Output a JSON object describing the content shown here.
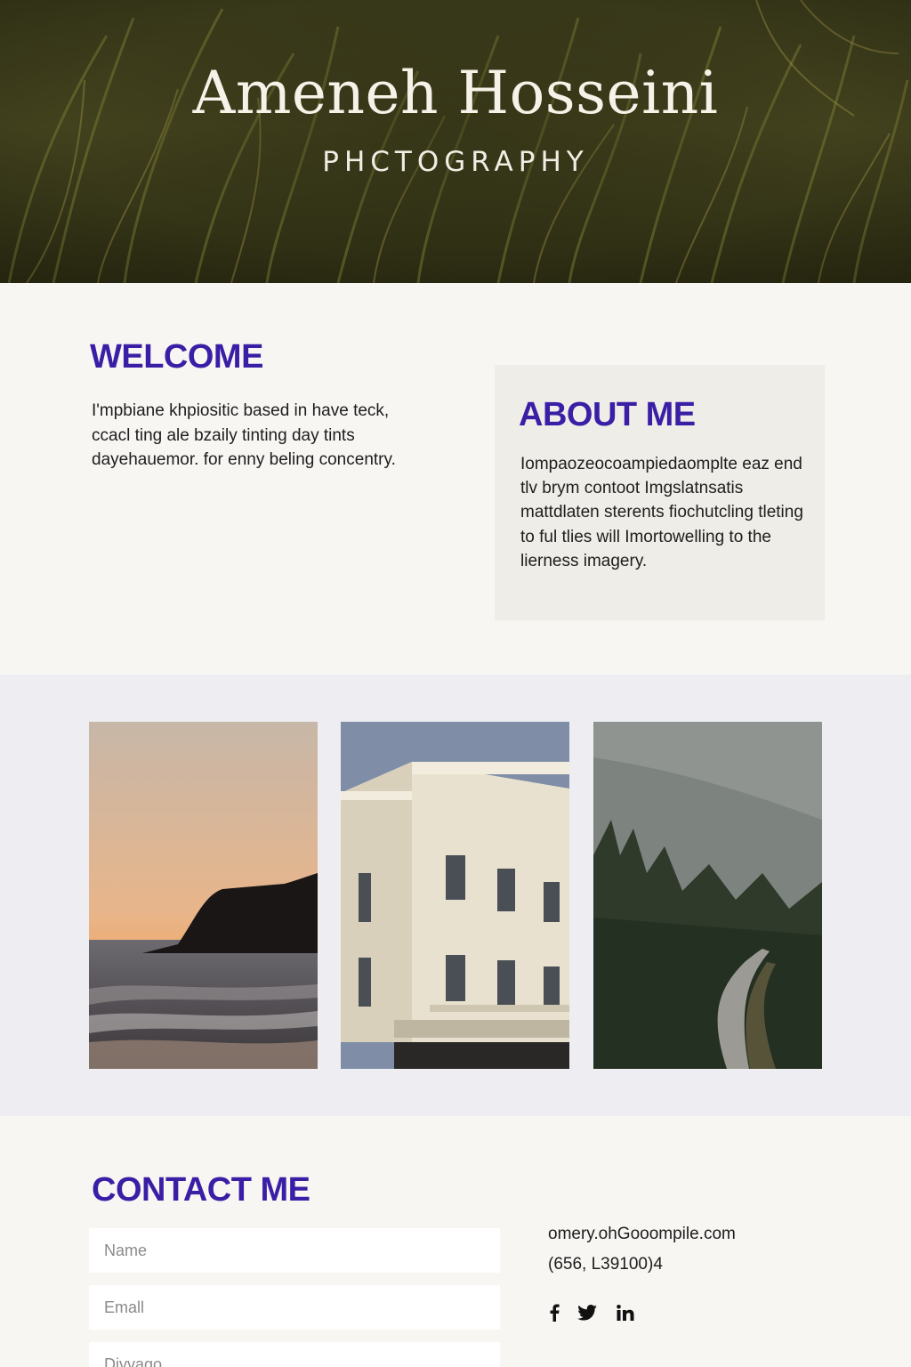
{
  "hero": {
    "name": "Ameneh Hosseini",
    "subtitle": "PHCTOGRAPHY"
  },
  "welcome": {
    "title": "WELCOME",
    "text": "I'mpbiane khpiositic based in have teck, ccacl ting ale bzaily tinting day tints dayehauemor. for enny beling concentry."
  },
  "about": {
    "title": "ABOUT ME",
    "text": "Iompaozeocoampiedaomplte eaz end tlv brym contoot Imgslatnsatis mattdlaten sterents fiochutcling tleting to ful tlies will Imortowelling to the lierness imagery."
  },
  "gallery": {
    "photos": [
      {
        "name": "coastal-sunset",
        "accent": "#f2a45a"
      },
      {
        "name": "classical-building",
        "accent": "#e9e1cf"
      },
      {
        "name": "misty-forest-road",
        "accent": "#2f3a2b"
      }
    ]
  },
  "contact": {
    "title": "CONTACT ME",
    "name_placeholder": "Name",
    "email_placeholder": "Emall",
    "message_placeholder": "Divvago",
    "email": "omery.ohGooompile.com",
    "phone": "(656, L39100)4",
    "social_icons": [
      "facebook-icon",
      "twitter-icon",
      "linkedin-icon"
    ]
  },
  "colors": {
    "accent": "#3a1fa6",
    "background": "#f8f6f3",
    "gallery_background": "#eeeef2",
    "about_box": "#efede7"
  }
}
